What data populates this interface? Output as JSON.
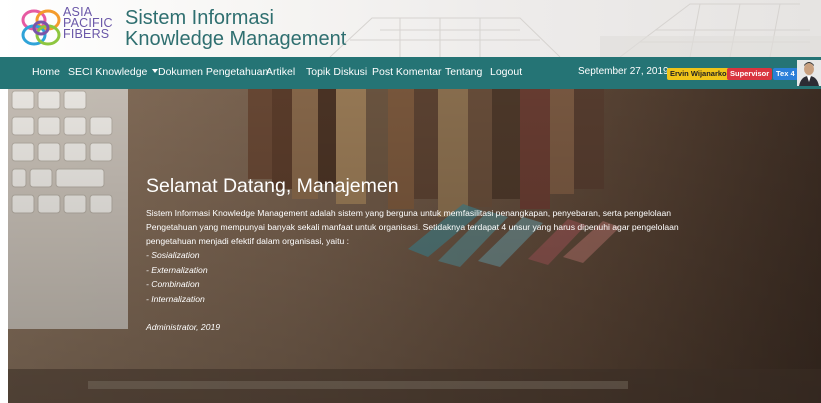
{
  "brand": {
    "logo_lines": [
      "ASIA",
      "PACIFIC",
      "FIBERS"
    ],
    "title_line1": "Sistem Informasi",
    "title_line2": "Knowledge Management"
  },
  "nav": {
    "items": [
      {
        "label": "Home"
      },
      {
        "label": "SECI Knowledge",
        "has_dropdown": true
      },
      {
        "label": "Dokumen Pengetahuan"
      },
      {
        "label": "Artikel"
      },
      {
        "label": "Topik Diskusi"
      },
      {
        "label": "Post Komentar"
      },
      {
        "label": "Tentang"
      },
      {
        "label": "Logout"
      }
    ],
    "date": "September 27, 2019",
    "user_badge": "Ervin Wijanarko",
    "role_badge": "Supervisor",
    "dept_badge": "Tex 4"
  },
  "hero": {
    "title": "Selamat Datang, Manajemen",
    "description": "Sistem Informasi Knowledge Management adalah sistem yang berguna untuk memfasilitasi penangkapan, penyebaran, serta pengelolaan Pengetahuan yang mempunyai banyak sekali manfaat untuk organisasi. Setidaknya terdapat 4 unsur yang harus dipenuhi agar pengelolaan pengetahuan menjadi efektif dalam organisasi, yaitu :",
    "list": [
      "- Sosialization",
      "- Externalization",
      "- Combination",
      "- Internalization"
    ],
    "signature": "Administrator, 2019"
  },
  "colors": {
    "navbar": "#257475",
    "title_teal": "#2f6f70",
    "brand_purple": "#6a57a8",
    "badge_user": "#f0c419",
    "badge_role": "#d9343f",
    "badge_dept": "#2b7fd9"
  }
}
